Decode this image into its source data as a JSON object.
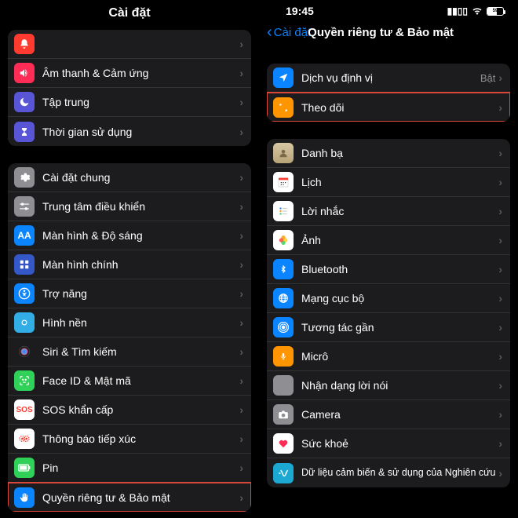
{
  "left": {
    "title": "Cài đặt",
    "group1": [
      {
        "icon": "bell-icon",
        "bg": "#ff3b30",
        "label": ""
      },
      {
        "icon": "speaker-icon",
        "bg": "#ff2d55",
        "label": "Âm thanh & Cảm ứng"
      },
      {
        "icon": "moon-icon",
        "bg": "#5856d6",
        "label": "Tập trung"
      },
      {
        "icon": "hourglass-icon",
        "bg": "#5856d6",
        "label": "Thời gian sử dụng"
      }
    ],
    "group2": [
      {
        "icon": "gear-icon",
        "bg": "#8e8e93",
        "label": "Cài đặt chung"
      },
      {
        "icon": "switches-icon",
        "bg": "#8e8e93",
        "label": "Trung tâm điều khiển"
      },
      {
        "icon": "text-aa-icon",
        "bg": "#0a84ff",
        "label": "Màn hình & Độ sáng"
      },
      {
        "icon": "grid-icon",
        "bg": "#3558c8",
        "label": "Màn hình chính"
      },
      {
        "icon": "accessibility-icon",
        "bg": "#0a84ff",
        "label": "Trợ năng"
      },
      {
        "icon": "wallpaper-icon",
        "bg": "#32ade6",
        "label": "Hình nền"
      },
      {
        "icon": "siri-icon",
        "bg": "#1c1c1e",
        "label": "Siri & Tìm kiếm"
      },
      {
        "icon": "faceid-icon",
        "bg": "#30d158",
        "label": "Face ID & Mật mã"
      },
      {
        "icon": "sos-icon",
        "bg": "#ff3b30",
        "label": "SOS khẩn cấp"
      },
      {
        "icon": "exposure-icon",
        "bg": "#ffffff",
        "label": "Thông báo tiếp xúc"
      },
      {
        "icon": "battery-icon",
        "bg": "#30d158",
        "label": "Pin"
      },
      {
        "icon": "hand-icon",
        "bg": "#0a84ff",
        "label": "Quyền riêng tư & Bảo mật",
        "highlighted": true
      }
    ]
  },
  "right": {
    "status": {
      "time": "19:45",
      "battery": "59"
    },
    "back_label": "Cài đặt",
    "title": "Quyền riêng tư & Bảo mật",
    "group1": [
      {
        "icon": "location-icon",
        "bg": "#0a84ff",
        "label": "Dịch vụ định vị",
        "value": "Bật"
      },
      {
        "icon": "tracking-icon",
        "bg": "#ff9500",
        "label": "Theo dõi",
        "highlighted": true
      }
    ],
    "group2": [
      {
        "icon": "contacts-icon",
        "bg": "#d8c7a5",
        "label": "Danh bạ"
      },
      {
        "icon": "calendar-icon",
        "bg": "#ffffff",
        "label": "Lịch"
      },
      {
        "icon": "reminders-icon",
        "bg": "#ffffff",
        "label": "Lời nhắc"
      },
      {
        "icon": "photos-icon",
        "bg": "#ffffff",
        "label": "Ảnh"
      },
      {
        "icon": "bluetooth-icon",
        "bg": "#0a84ff",
        "label": "Bluetooth"
      },
      {
        "icon": "network-icon",
        "bg": "#0a84ff",
        "label": "Mạng cục bộ"
      },
      {
        "icon": "nearby-icon",
        "bg": "#0a84ff",
        "label": "Tương tác gần"
      },
      {
        "icon": "mic-icon",
        "bg": "#ff9500",
        "label": "Micrô"
      },
      {
        "icon": "speech-icon",
        "bg": "#8e8e93",
        "label": "Nhận dạng lời nói"
      },
      {
        "icon": "camera-icon",
        "bg": "#8e8e93",
        "label": "Camera"
      },
      {
        "icon": "health-icon",
        "bg": "#ffffff",
        "label": "Sức khoẻ"
      },
      {
        "icon": "research-icon",
        "bg": "#1ba9d3",
        "label": "Dữ liệu cảm biến & sử dụng của Nghiên cứu"
      }
    ]
  }
}
